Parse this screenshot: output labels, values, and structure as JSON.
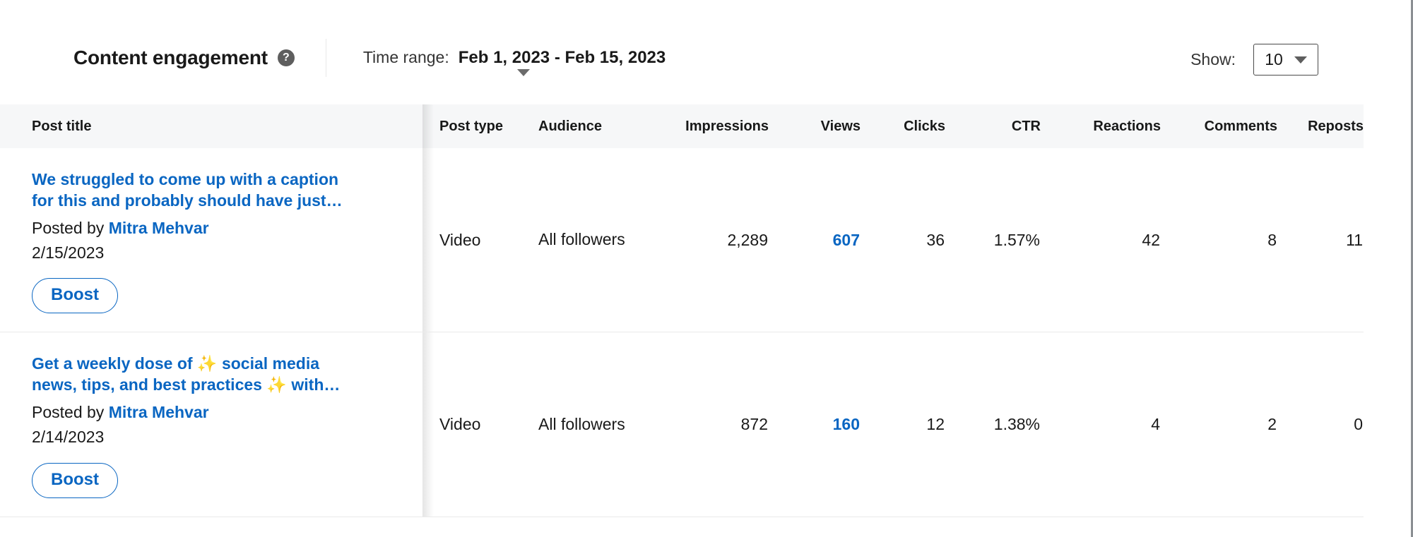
{
  "header": {
    "title": "Content engagement",
    "help_icon": "question-mark-circle-icon",
    "time_range_label": "Time range:",
    "time_range_value": "Feb 1, 2023 - Feb 15, 2023",
    "show_label": "Show:",
    "show_value": "10"
  },
  "table": {
    "columns": [
      "Post title",
      "Post type",
      "Audience",
      "Impressions",
      "Views",
      "Clicks",
      "CTR",
      "Reactions",
      "Comments",
      "Reposts"
    ],
    "posted_by_prefix": "Posted by",
    "boost_label": "Boost",
    "rows": [
      {
        "title": "We struggled to come up with a caption for this and probably should have just…",
        "title_parts": [
          "We struggled to come up with a caption for this and probably should have just…"
        ],
        "author": "Mitra Mehvar",
        "date": "2/15/2023",
        "post_type": "Video",
        "audience": "All followers",
        "impressions": "2,289",
        "views": "607",
        "clicks": "36",
        "ctr": "1.57%",
        "reactions": "42",
        "comments": "8",
        "reposts": "11"
      },
      {
        "title": "Get a weekly dose of ✨ social media news, tips, and best practices ✨ with…",
        "author": "Mitra Mehvar",
        "date": "2/14/2023",
        "post_type": "Video",
        "audience": "All followers",
        "impressions": "872",
        "views": "160",
        "clicks": "12",
        "ctr": "1.38%",
        "reactions": "4",
        "comments": "2",
        "reposts": "0"
      }
    ]
  },
  "colors": {
    "link": "#0a66c2",
    "header_bg": "#f6f7f8",
    "text": "#000000e6",
    "sparkle": "#f2c14b"
  }
}
